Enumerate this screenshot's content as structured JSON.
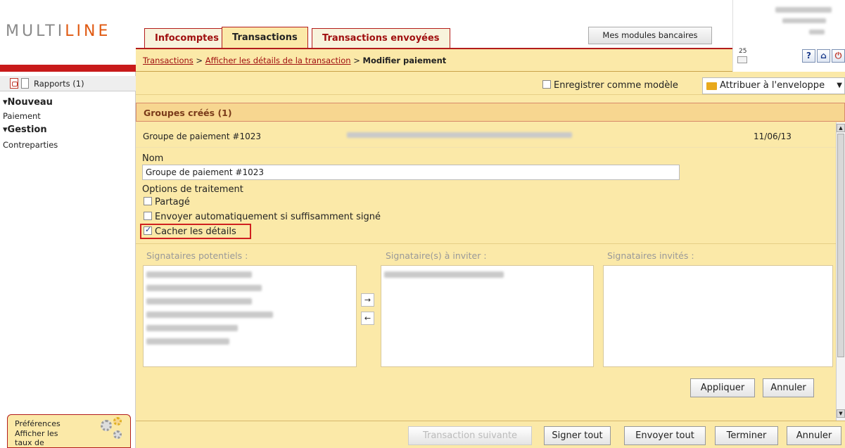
{
  "logo": {
    "text_main": "MULTI",
    "text_accent": "LINE"
  },
  "tabs": [
    {
      "label": "Infocomptes"
    },
    {
      "label": "Transactions"
    },
    {
      "label": "Transactions envoyées"
    }
  ],
  "modules_button": "Mes modules bancaires",
  "breadcrumb": {
    "link1": "Transactions",
    "sep1": " > ",
    "link2": "Afficher les détails de la transaction",
    "sep2": " > ",
    "current": "Modifier paiement"
  },
  "userbox": {
    "mail_count": "25"
  },
  "sidebar": {
    "reports": "Rapports (1)",
    "nouveau": "Nouveau",
    "paiement": "Paiement",
    "gestion": "Gestion",
    "contreparties": "Contreparties",
    "prefs_title": "Préférences",
    "prefs_rates": "Afficher les taux de change"
  },
  "options_bar": {
    "save_template": "Enregistrer comme modèle",
    "assign_envelope": "Attribuer à l'enveloppe"
  },
  "section": {
    "title": "Groupes créés (1)"
  },
  "group": {
    "title": "Groupe de paiement #1023",
    "date": "11/06/13"
  },
  "form": {
    "name_label": "Nom",
    "name_value": "Groupe de paiement #1023",
    "processing_label": "Options de traitement",
    "opt_shared": "Partagé",
    "opt_auto_send": "Envoyer automatiquement si suffisamment signé",
    "opt_hide_details": "Cacher les détails"
  },
  "signers": {
    "potential_label": "Signataires potentiels :",
    "to_invite_label": "Signataire(s) à inviter :",
    "invited_label": "Signataires invités :",
    "apply": "Appliquer",
    "cancel": "Annuler"
  },
  "footer": {
    "next_transaction": "Transaction suivante",
    "sign_all": "Signer tout",
    "send_all": "Envoyer tout",
    "finish": "Terminer",
    "cancel": "Annuler"
  },
  "colors": {
    "brand_red": "#b31c1c",
    "panel_yellow": "#fbe9a8",
    "accent_orange": "#e05a12"
  }
}
